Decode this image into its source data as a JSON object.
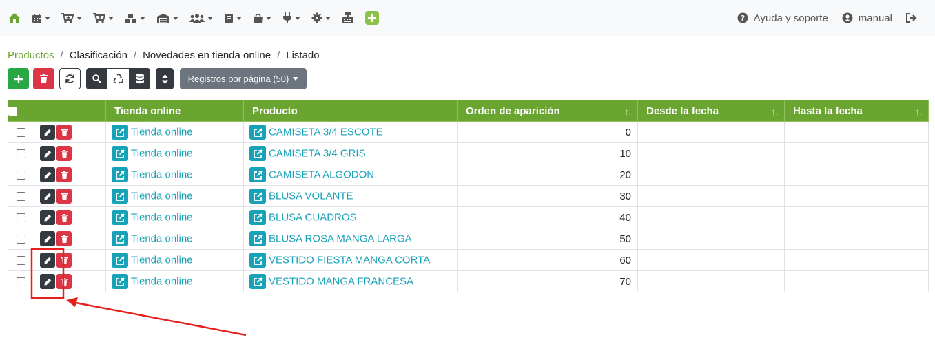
{
  "navbar": {
    "icons": [
      "home-icon",
      "calendar-icon",
      "cart-down-icon",
      "cart-up-icon",
      "boxes-icon",
      "warehouse-icon",
      "users-icon",
      "book-icon",
      "bag-icon",
      "plug-icon",
      "gear-icon",
      "cash-register-icon",
      "plus-square-icon"
    ],
    "help_label": "Ayuda y soporte",
    "user_label": "manual"
  },
  "breadcrumb": [
    "Productos",
    "Clasificación",
    "Novedades en tienda online",
    "Listado"
  ],
  "toolbar": {
    "page_size_label": "Registros por página (50)"
  },
  "table": {
    "columns": [
      "Tienda online",
      "Producto",
      "Orden de aparición",
      "Desde la fecha",
      "Hasta la fecha"
    ],
    "rows": [
      {
        "store": "Tienda online",
        "product": "CAMISETA 3/4 ESCOTE",
        "order": "0",
        "from": "",
        "to": ""
      },
      {
        "store": "Tienda online",
        "product": "CAMISETA 3/4 GRIS",
        "order": "10",
        "from": "",
        "to": ""
      },
      {
        "store": "Tienda online",
        "product": "CAMISETA ALGODON",
        "order": "20",
        "from": "",
        "to": ""
      },
      {
        "store": "Tienda online",
        "product": "BLUSA VOLANTE",
        "order": "30",
        "from": "",
        "to": ""
      },
      {
        "store": "Tienda online",
        "product": "BLUSA CUADROS",
        "order": "40",
        "from": "",
        "to": ""
      },
      {
        "store": "Tienda online",
        "product": "BLUSA ROSA MANGA LARGA",
        "order": "50",
        "from": "",
        "to": ""
      },
      {
        "store": "Tienda online",
        "product": "VESTIDO FIESTA MANGA CORTA",
        "order": "60",
        "from": "",
        "to": ""
      },
      {
        "store": "Tienda online",
        "product": "VESTIDO MANGA FRANCESA",
        "order": "70",
        "from": "",
        "to": ""
      }
    ]
  },
  "colors": {
    "accent_green": "#6aa532",
    "danger_red": "#dc3545",
    "link_teal": "#17a2b8",
    "dark": "#343a40",
    "annotation_red": "#e8201d"
  }
}
